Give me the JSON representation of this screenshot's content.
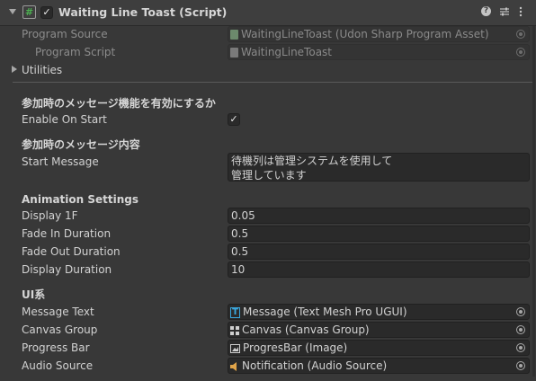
{
  "header": {
    "title": "Waiting Line Toast (Script)",
    "enabled_check": "✓"
  },
  "program_source": {
    "label": "Program Source",
    "value": "WaitingLineToast (Udon Sharp Program Asset)"
  },
  "program_script": {
    "label": "Program Script",
    "value": "WaitingLineToast"
  },
  "utilities": {
    "label": "Utilities"
  },
  "join_message_enable": {
    "header": "参加時のメッセージ機能を有効にするか",
    "label": "Enable On Start",
    "check": "✓"
  },
  "join_message_content": {
    "header": "参加時のメッセージ内容",
    "label": "Start Message",
    "line1": "待機列は管理システムを使用して",
    "line2": "管理しています"
  },
  "animation_settings": {
    "header": "Animation Settings",
    "rows": [
      {
        "label": "Display 1F",
        "value": "0.05"
      },
      {
        "label": "Fade In Duration",
        "value": "0.5"
      },
      {
        "label": "Fade Out Duration",
        "value": "0.5"
      },
      {
        "label": "Display Duration",
        "value": "10"
      }
    ]
  },
  "ui": {
    "header": "UI系",
    "rows": [
      {
        "label": "Message Text",
        "value": "Message (Text Mesh Pro UGUI)",
        "icon": "textmeshpro-icon"
      },
      {
        "label": "Canvas Group",
        "value": "Canvas (Canvas Group)",
        "icon": "canvas-group-icon"
      },
      {
        "label": "Progress Bar",
        "value": "ProgresBar (Image)",
        "icon": "image-icon"
      },
      {
        "label": "Audio Source",
        "value": "Notification (Audio Source)",
        "icon": "audio-source-icon"
      }
    ]
  },
  "colors": {
    "background": "#383838",
    "header": "#3e3e3e",
    "field": "#2a2a2a",
    "script_icon": "#4caf50",
    "tmp_icon": "#3aa6dc",
    "audio_icon": "#e0a44a"
  }
}
